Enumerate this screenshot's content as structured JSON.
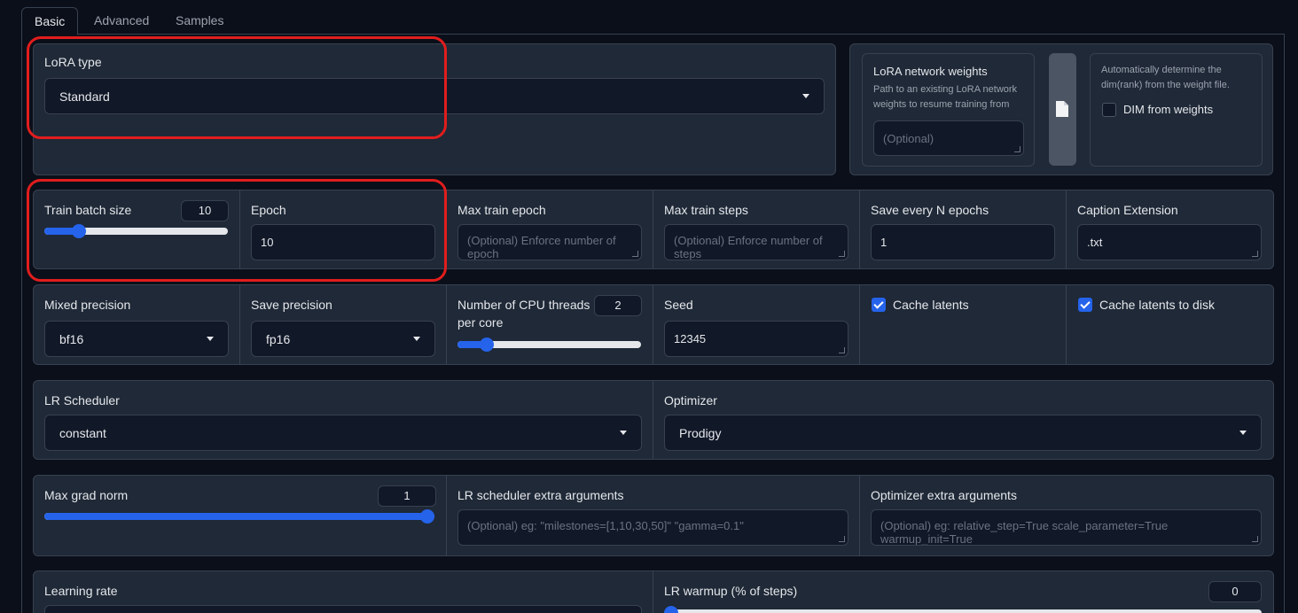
{
  "tabs": [
    "Basic",
    "Advanced",
    "Samples"
  ],
  "lora_type": {
    "label": "LoRA type",
    "value": "Standard"
  },
  "network_weights": {
    "title": "LoRA network weights",
    "desc": "Path to an existing LoRA network weights to resume training from",
    "placeholder": "(Optional)"
  },
  "dim_from_weights": {
    "desc": "Automatically determine the dim(rank) from the weight file.",
    "label": "DIM from weights",
    "checked": false
  },
  "row1": {
    "train_batch_size": {
      "label": "Train batch size",
      "value": "10",
      "fraction": 0.16
    },
    "epoch": {
      "label": "Epoch",
      "value": "10"
    },
    "max_train_epoch": {
      "label": "Max train epoch",
      "placeholder": "(Optional) Enforce number of epoch"
    },
    "max_train_steps": {
      "label": "Max train steps",
      "placeholder": "(Optional) Enforce number of steps"
    },
    "save_every_n_epochs": {
      "label": "Save every N epochs",
      "value": "1"
    },
    "caption_extension": {
      "label": "Caption Extension",
      "value": ".txt"
    }
  },
  "row2": {
    "mixed_precision": {
      "label": "Mixed precision",
      "value": "bf16"
    },
    "save_precision": {
      "label": "Save precision",
      "value": "fp16"
    },
    "cpu_threads": {
      "label": "Number of CPU threads per core",
      "value": "2",
      "fraction": 0.13
    },
    "seed": {
      "label": "Seed",
      "value": "12345"
    },
    "cache_latents": {
      "label": "Cache latents",
      "checked": true
    },
    "cache_latents_to_disk": {
      "label": "Cache latents to disk",
      "checked": true
    }
  },
  "row3": {
    "lr_scheduler": {
      "label": "LR Scheduler",
      "value": "constant"
    },
    "optimizer": {
      "label": "Optimizer",
      "value": "Prodigy"
    }
  },
  "row4": {
    "max_grad_norm": {
      "label": "Max grad norm",
      "value": "1",
      "fraction": 1.0
    },
    "lr_scheduler_args": {
      "label": "LR scheduler extra arguments",
      "placeholder": "(Optional) eg: \"milestones=[1,10,30,50]\" \"gamma=0.1\""
    },
    "optimizer_args": {
      "label": "Optimizer extra arguments",
      "placeholder": "(Optional) eg: relative_step=True scale_parameter=True warmup_init=True"
    }
  },
  "row5": {
    "learning_rate": {
      "label": "Learning rate"
    },
    "lr_warmup": {
      "label": "LR warmup (% of steps)",
      "value": "0",
      "fraction": 0.0
    }
  },
  "colors": {
    "accent": "#2563eb",
    "highlight": "#e11d1d"
  }
}
